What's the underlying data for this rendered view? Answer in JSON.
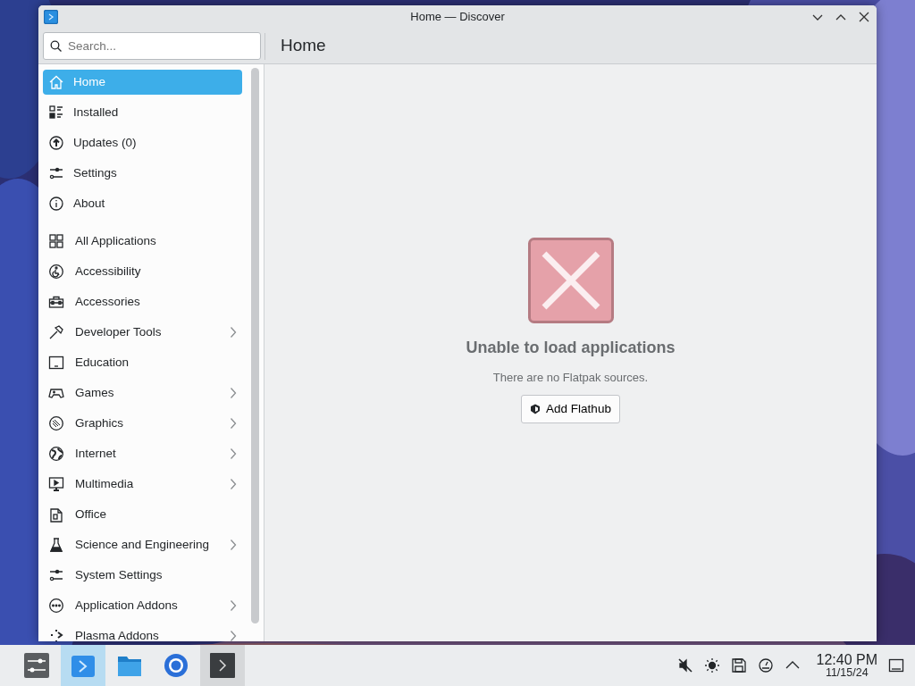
{
  "window": {
    "title": "Home — Discover"
  },
  "search": {
    "placeholder": "Search..."
  },
  "page_title": "Home",
  "sidebar": {
    "items": [
      {
        "label": "Home",
        "selected": true
      },
      {
        "label": "Installed",
        "selected": false
      },
      {
        "label": "Updates (0)",
        "selected": false
      },
      {
        "label": "Settings",
        "selected": false
      },
      {
        "label": "About",
        "selected": false
      }
    ],
    "categories": [
      {
        "label": "All Applications",
        "selected": false,
        "has_children": false
      },
      {
        "label": "Accessibility",
        "selected": false,
        "has_children": false
      },
      {
        "label": "Accessories",
        "selected": false,
        "has_children": false
      },
      {
        "label": "Developer Tools",
        "selected": false,
        "has_children": true
      },
      {
        "label": "Education",
        "selected": false,
        "has_children": false
      },
      {
        "label": "Games",
        "selected": false,
        "has_children": true
      },
      {
        "label": "Graphics",
        "selected": false,
        "has_children": true
      },
      {
        "label": "Internet",
        "selected": false,
        "has_children": true
      },
      {
        "label": "Multimedia",
        "selected": false,
        "has_children": true
      },
      {
        "label": "Office",
        "selected": false,
        "has_children": false
      },
      {
        "label": "Science and Engineering",
        "selected": false,
        "has_children": true
      },
      {
        "label": "System Settings",
        "selected": false,
        "has_children": false
      },
      {
        "label": "Application Addons",
        "selected": false,
        "has_children": true
      },
      {
        "label": "Plasma Addons",
        "selected": false,
        "has_children": true
      }
    ]
  },
  "empty_state": {
    "title": "Unable to load applications",
    "message": "There are no Flatpak sources.",
    "button": "Add Flathub"
  },
  "taskbar": {
    "tasks": [
      {
        "selected": false,
        "hovered": false
      },
      {
        "selected": true,
        "hovered": false
      },
      {
        "selected": false,
        "hovered": false
      },
      {
        "selected": false,
        "hovered": false
      },
      {
        "selected": false,
        "hovered": true
      }
    ]
  },
  "tray": {
    "time": "12:40 PM",
    "date": "11/15/24"
  }
}
